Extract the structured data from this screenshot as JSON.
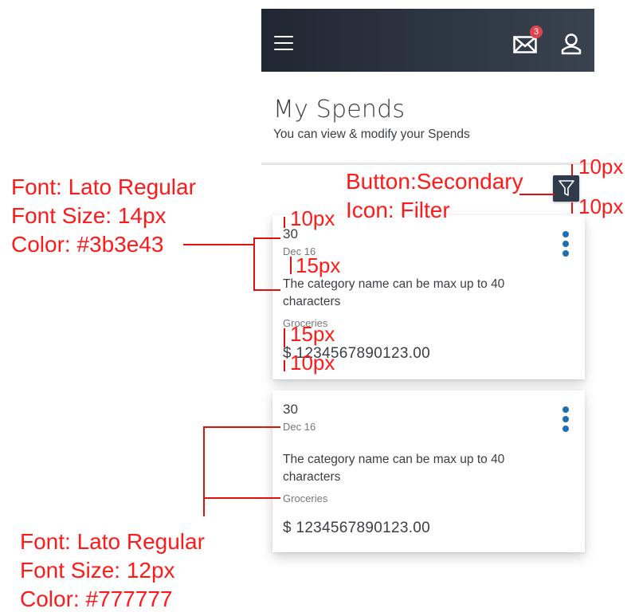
{
  "header": {
    "menu_icon": "hamburger-icon",
    "mail_icon": "envelope-icon",
    "mail_badge": "3",
    "profile_icon": "user-icon"
  },
  "page": {
    "title": "My Spends",
    "subtitle": "You can view & modify your Spends",
    "filter_icon": "filter-icon"
  },
  "cards": [
    {
      "day": "30",
      "date": "Dec 16",
      "category_line1": "The category name can be max up to 40",
      "category_line2": "characters",
      "group": "Groceries",
      "amount": "$ 1234567890123.00"
    },
    {
      "day": "30",
      "date": "Dec 16",
      "category_line1": "The category name can be max up to 40",
      "category_line2": "characters",
      "group": "Groceries",
      "amount": "$ 1234567890123.00"
    }
  ],
  "annotations": {
    "font1": "Font: Lato Regular",
    "size1": "Font Size: 14px",
    "color1": "Color: #3b3e43",
    "button_type": "Button:Secondary",
    "button_icon": "Icon: Filter",
    "spacing_10": "10px",
    "spacing_15": "15px",
    "font2": "Font: Lato Regular",
    "size2": "Font Size: 12px",
    "color2": "Color: #777777"
  },
  "colors": {
    "header_dark": "#1f2733",
    "primary_text": "#3b3e43",
    "secondary_text": "#777777",
    "kebab": "#1f6fb2",
    "badge": "#e0444a",
    "annotation": "#ff1a1a"
  }
}
